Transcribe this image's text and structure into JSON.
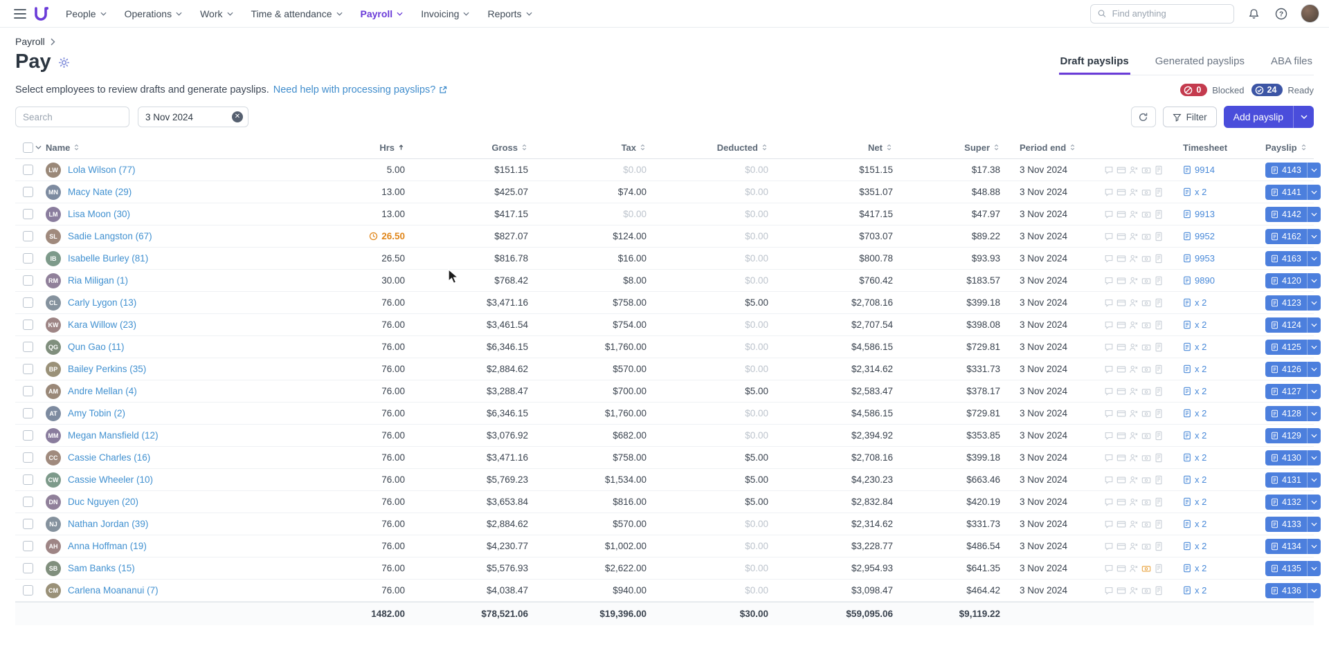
{
  "nav": {
    "items": [
      {
        "label": "People"
      },
      {
        "label": "Operations"
      },
      {
        "label": "Work"
      },
      {
        "label": "Time & attendance"
      },
      {
        "label": "Payroll",
        "active": true
      },
      {
        "label": "Invoicing"
      },
      {
        "label": "Reports"
      }
    ],
    "search_placeholder": "Find anything"
  },
  "breadcrumb": "Payroll",
  "page": {
    "title": "Pay"
  },
  "tabs": [
    {
      "label": "Draft payslips",
      "active": true
    },
    {
      "label": "Generated payslips"
    },
    {
      "label": "ABA files"
    }
  ],
  "subheader": {
    "text": "Select employees to review drafts and generate payslips.",
    "link": "Need help with processing payslips?",
    "blocked_count": "0",
    "blocked_label": "Blocked",
    "ready_count": "24",
    "ready_label": "Ready"
  },
  "toolbar": {
    "search_placeholder": "Search",
    "date_value": "3 Nov 2024",
    "filter_label": "Filter",
    "add_payslip_label": "Add payslip"
  },
  "table": {
    "columns": [
      {
        "label": "Name"
      },
      {
        "label": "Hrs"
      },
      {
        "label": "Gross"
      },
      {
        "label": "Tax"
      },
      {
        "label": "Deducted"
      },
      {
        "label": "Net"
      },
      {
        "label": "Super"
      },
      {
        "label": "Period end"
      },
      {
        "label": "Timesheet"
      },
      {
        "label": "Payslip"
      }
    ],
    "rows": [
      {
        "name": "Lola Wilson (77)",
        "hrs": "5.00",
        "gross": "$151.15",
        "tax": "$0.00",
        "deducted": "$0.00",
        "net": "$151.15",
        "super": "$17.38",
        "period_end": "3 Nov 2024",
        "timesheet": "9914",
        "payslip": "4143"
      },
      {
        "name": "Macy Nate (29)",
        "hrs": "13.00",
        "gross": "$425.07",
        "tax": "$74.00",
        "deducted": "$0.00",
        "net": "$351.07",
        "super": "$48.88",
        "period_end": "3 Nov 2024",
        "timesheet": "x 2",
        "payslip": "4141"
      },
      {
        "name": "Lisa Moon (30)",
        "hrs": "13.00",
        "gross": "$417.15",
        "tax": "$0.00",
        "deducted": "$0.00",
        "net": "$417.15",
        "super": "$47.97",
        "period_end": "3 Nov 2024",
        "timesheet": "9913",
        "payslip": "4142"
      },
      {
        "name": "Sadie Langston (67)",
        "hrs": "26.50",
        "hrs_warning": true,
        "gross": "$827.07",
        "tax": "$124.00",
        "deducted": "$0.00",
        "net": "$703.07",
        "super": "$89.22",
        "period_end": "3 Nov 2024",
        "timesheet": "9952",
        "payslip": "4162"
      },
      {
        "name": "Isabelle Burley (81)",
        "hrs": "26.50",
        "gross": "$816.78",
        "tax": "$16.00",
        "deducted": "$0.00",
        "net": "$800.78",
        "super": "$93.93",
        "period_end": "3 Nov 2024",
        "timesheet": "9953",
        "payslip": "4163"
      },
      {
        "name": "Ria Miligan (1)",
        "hrs": "30.00",
        "gross": "$768.42",
        "tax": "$8.00",
        "deducted": "$0.00",
        "net": "$760.42",
        "super": "$183.57",
        "period_end": "3 Nov 2024",
        "timesheet": "9890",
        "payslip": "4120"
      },
      {
        "name": "Carly Lygon (13)",
        "hrs": "76.00",
        "gross": "$3,471.16",
        "tax": "$758.00",
        "deducted": "$5.00",
        "net": "$2,708.16",
        "super": "$399.18",
        "period_end": "3 Nov 2024",
        "timesheet": "x 2",
        "payslip": "4123"
      },
      {
        "name": "Kara Willow (23)",
        "hrs": "76.00",
        "gross": "$3,461.54",
        "tax": "$754.00",
        "deducted": "$0.00",
        "net": "$2,707.54",
        "super": "$398.08",
        "period_end": "3 Nov 2024",
        "timesheet": "x 2",
        "payslip": "4124"
      },
      {
        "name": "Qun Gao (11)",
        "hrs": "76.00",
        "gross": "$6,346.15",
        "tax": "$1,760.00",
        "deducted": "$0.00",
        "net": "$4,586.15",
        "super": "$729.81",
        "period_end": "3 Nov 2024",
        "timesheet": "x 2",
        "payslip": "4125"
      },
      {
        "name": "Bailey Perkins (35)",
        "hrs": "76.00",
        "gross": "$2,884.62",
        "tax": "$570.00",
        "deducted": "$0.00",
        "net": "$2,314.62",
        "super": "$331.73",
        "period_end": "3 Nov 2024",
        "timesheet": "x 2",
        "payslip": "4126"
      },
      {
        "name": "Andre Mellan (4)",
        "hrs": "76.00",
        "gross": "$3,288.47",
        "tax": "$700.00",
        "deducted": "$5.00",
        "net": "$2,583.47",
        "super": "$378.17",
        "period_end": "3 Nov 2024",
        "timesheet": "x 2",
        "payslip": "4127"
      },
      {
        "name": "Amy Tobin (2)",
        "hrs": "76.00",
        "gross": "$6,346.15",
        "tax": "$1,760.00",
        "deducted": "$0.00",
        "net": "$4,586.15",
        "super": "$729.81",
        "period_end": "3 Nov 2024",
        "timesheet": "x 2",
        "payslip": "4128"
      },
      {
        "name": "Megan Mansfield (12)",
        "hrs": "76.00",
        "gross": "$3,076.92",
        "tax": "$682.00",
        "deducted": "$0.00",
        "net": "$2,394.92",
        "super": "$353.85",
        "period_end": "3 Nov 2024",
        "timesheet": "x 2",
        "payslip": "4129"
      },
      {
        "name": "Cassie Charles (16)",
        "hrs": "76.00",
        "gross": "$3,471.16",
        "tax": "$758.00",
        "deducted": "$5.00",
        "net": "$2,708.16",
        "super": "$399.18",
        "period_end": "3 Nov 2024",
        "timesheet": "x 2",
        "payslip": "4130"
      },
      {
        "name": "Cassie Wheeler (10)",
        "hrs": "76.00",
        "gross": "$5,769.23",
        "tax": "$1,534.00",
        "deducted": "$5.00",
        "net": "$4,230.23",
        "super": "$663.46",
        "period_end": "3 Nov 2024",
        "timesheet": "x 2",
        "payslip": "4131"
      },
      {
        "name": "Duc Nguyen (20)",
        "hrs": "76.00",
        "gross": "$3,653.84",
        "tax": "$816.00",
        "deducted": "$5.00",
        "net": "$2,832.84",
        "super": "$420.19",
        "period_end": "3 Nov 2024",
        "timesheet": "x 2",
        "payslip": "4132"
      },
      {
        "name": "Nathan Jordan (39)",
        "hrs": "76.00",
        "gross": "$2,884.62",
        "tax": "$570.00",
        "deducted": "$0.00",
        "net": "$2,314.62",
        "super": "$331.73",
        "period_end": "3 Nov 2024",
        "timesheet": "x 2",
        "payslip": "4133"
      },
      {
        "name": "Anna Hoffman (19)",
        "hrs": "76.00",
        "gross": "$4,230.77",
        "tax": "$1,002.00",
        "deducted": "$0.00",
        "net": "$3,228.77",
        "super": "$486.54",
        "period_end": "3 Nov 2024",
        "timesheet": "x 2",
        "payslip": "4134"
      },
      {
        "name": "Sam Banks (15)",
        "hrs": "76.00",
        "gross": "$5,576.93",
        "tax": "$2,622.00",
        "deducted": "$0.00",
        "net": "$2,954.93",
        "super": "$641.35",
        "period_end": "3 Nov 2024",
        "timesheet": "x 2",
        "payslip": "4135",
        "timesheet_alert": true
      },
      {
        "name": "Carlena Moananui (7)",
        "hrs": "76.00",
        "gross": "$4,038.47",
        "tax": "$940.00",
        "deducted": "$0.00",
        "net": "$3,098.47",
        "super": "$464.42",
        "period_end": "3 Nov 2024",
        "timesheet": "x 2",
        "payslip": "4136"
      }
    ],
    "totals": {
      "hrs": "1482.00",
      "gross": "$78,521.06",
      "tax": "$19,396.00",
      "deducted": "$30.00",
      "net": "$59,095.06",
      "super": "$9,119.22"
    }
  }
}
